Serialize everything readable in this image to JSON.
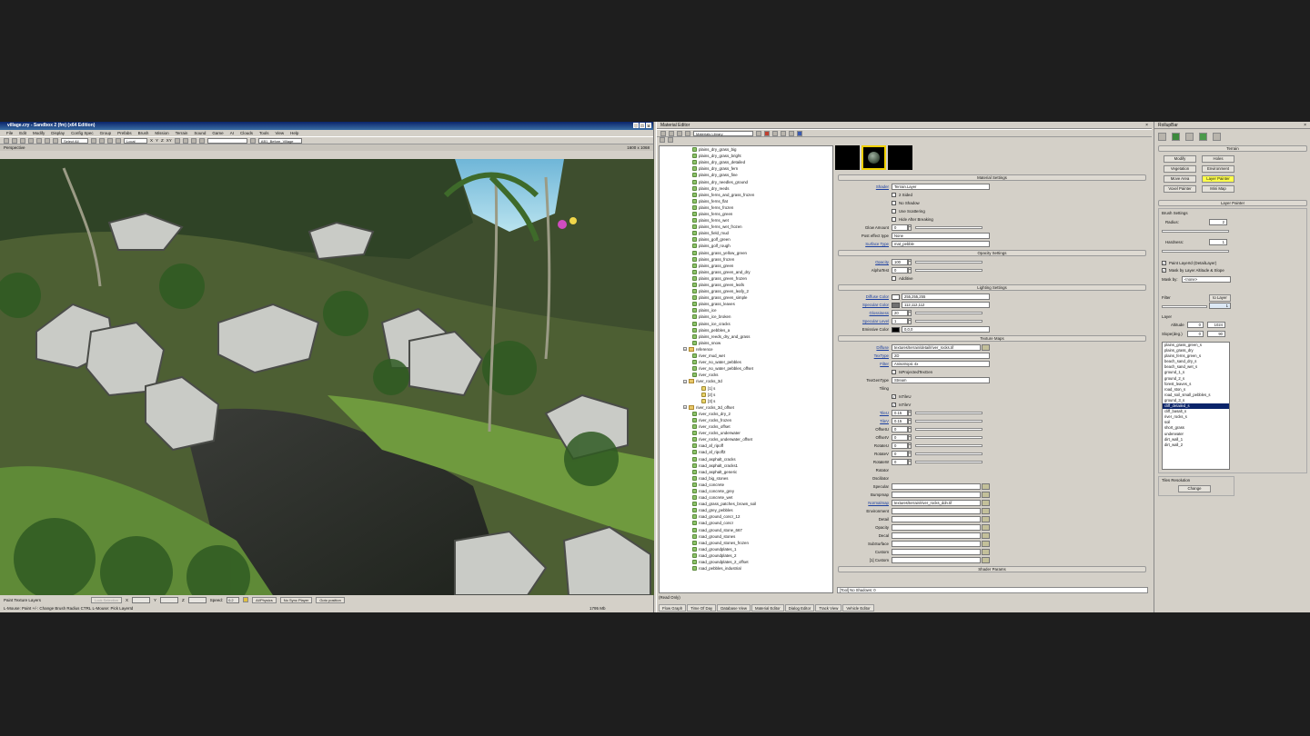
{
  "sandbox": {
    "title": "village.cry - Sandbox 2 (fm) (x64 Edition)",
    "menu": [
      "File",
      "Edit",
      "Modify",
      "Display",
      "Config Spec",
      "Group",
      "Prefabs",
      "Brush",
      "Mission",
      "Terrain",
      "Sound",
      "Game",
      "AI",
      "Clouds",
      "Tools",
      "View",
      "Help"
    ],
    "select_filter": "Select All",
    "coord_system": "Local",
    "axes": [
      "X",
      "Y",
      "Z",
      "XY"
    ],
    "camera_name": "AB1_Before_Village",
    "viewport_label": "Perspective",
    "viewport_size": "1600 x 1068",
    "status": {
      "mode": "Paint Texture Layers",
      "lock_selection": "Lock Selection",
      "x_label": "X",
      "y_label": "Y",
      "z_label": "Z",
      "speed_label": "Speed:",
      "speed_value": "0.2",
      "ai_physics": "AI/Physics",
      "no_sync": "No Sync Player",
      "goto": "Goto position",
      "hint": "L-Mouse: Paint   +/-: Change Brush Radius   CTRL L-Mouse: Pick LayerId",
      "memory": "1795 Mb"
    }
  },
  "material_editor": {
    "title": "Material Editor",
    "library_select": "Materials Library",
    "tree": [
      {
        "label": "plains_dry_grass_big",
        "type": "item"
      },
      {
        "label": "plains_dry_grass_bright",
        "type": "item"
      },
      {
        "label": "plains_dry_grass_detailed",
        "type": "item"
      },
      {
        "label": "plains_dry_grass_fern",
        "type": "item"
      },
      {
        "label": "plains_dry_grass_fine",
        "type": "item"
      },
      {
        "label": "plains_dry_needles_ground",
        "type": "item"
      },
      {
        "label": "plains_dry_reeds",
        "type": "item"
      },
      {
        "label": "plains_ferns_and_grass_frozen",
        "type": "item"
      },
      {
        "label": "plains_ferns_flat",
        "type": "item"
      },
      {
        "label": "plains_ferns_frozen",
        "type": "item"
      },
      {
        "label": "plains_ferns_green",
        "type": "item"
      },
      {
        "label": "plains_ferns_wet",
        "type": "item"
      },
      {
        "label": "plains_ferns_wet_frozen",
        "type": "item"
      },
      {
        "label": "plains_field_mud",
        "type": "item"
      },
      {
        "label": "plains_golf_green",
        "type": "item"
      },
      {
        "label": "plains_golf_rough",
        "type": "item"
      },
      {
        "label": "plains_grass_yellow_green",
        "type": "item"
      },
      {
        "label": "plains_grass_frozen",
        "type": "item"
      },
      {
        "label": "plains_grass_green",
        "type": "item"
      },
      {
        "label": "plains_grass_green_and_dry",
        "type": "item"
      },
      {
        "label": "plains_grass_green_frozen",
        "type": "item"
      },
      {
        "label": "plains_grass_green_leafs",
        "type": "item"
      },
      {
        "label": "plains_grass_green_leafy_2",
        "type": "item"
      },
      {
        "label": "plains_grass_green_simple",
        "type": "item"
      },
      {
        "label": "plains_grass_leaves",
        "type": "item"
      },
      {
        "label": "plains_ice",
        "type": "item"
      },
      {
        "label": "plains_ice_broken",
        "type": "item"
      },
      {
        "label": "plains_ice_cracks",
        "type": "item"
      },
      {
        "label": "plains_pebbles_a",
        "type": "item"
      },
      {
        "label": "plains_reeds_dry_and_grass",
        "type": "item"
      },
      {
        "label": "plains_snow",
        "type": "item"
      },
      {
        "label": "reference",
        "type": "folder"
      },
      {
        "label": "river_mud_wet",
        "type": "item"
      },
      {
        "label": "river_no_water_pebbles",
        "type": "item"
      },
      {
        "label": "river_no_water_pebbles_offset",
        "type": "item"
      },
      {
        "label": "river_rocks",
        "type": "item"
      },
      {
        "label": "river_rocks_3d",
        "type": "folder"
      },
      {
        "label": "[1] s",
        "type": "sub"
      },
      {
        "label": "[2] s",
        "type": "sub"
      },
      {
        "label": "[3] s",
        "type": "sub"
      },
      {
        "label": "river_rocks_3d_offset",
        "type": "folder"
      },
      {
        "label": "river_rocks_dry_2",
        "type": "item"
      },
      {
        "label": "river_rocks_frozen",
        "type": "item"
      },
      {
        "label": "river_rocks_offset",
        "type": "item"
      },
      {
        "label": "river_rocks_underwater",
        "type": "item"
      },
      {
        "label": "river_rocks_underwater_offset",
        "type": "item"
      },
      {
        "label": "road_af_ripoff",
        "type": "item"
      },
      {
        "label": "road_af_ripoff2",
        "type": "item"
      },
      {
        "label": "road_asphalt_cracks",
        "type": "item"
      },
      {
        "label": "road_asphalt_cracks1",
        "type": "item"
      },
      {
        "label": "road_asphalt_generic",
        "type": "item"
      },
      {
        "label": "road_big_stones",
        "type": "item"
      },
      {
        "label": "road_concrete",
        "type": "item"
      },
      {
        "label": "road_concrete_grey",
        "type": "item"
      },
      {
        "label": "road_concrete_wet",
        "type": "item"
      },
      {
        "label": "road_grass_patches_brown_soil",
        "type": "item"
      },
      {
        "label": "road_grey_pebbles",
        "type": "item"
      },
      {
        "label": "road_ground_concr_12",
        "type": "item"
      },
      {
        "label": "road_ground_concr",
        "type": "item"
      },
      {
        "label": "road_ground_stone_667",
        "type": "item"
      },
      {
        "label": "road_ground_stones",
        "type": "item"
      },
      {
        "label": "road_ground_stones_frozen",
        "type": "item"
      },
      {
        "label": "road_groundplates_1",
        "type": "item"
      },
      {
        "label": "road_groundplates_2",
        "type": "item"
      },
      {
        "label": "road_groundplates_2_offset",
        "type": "item"
      },
      {
        "label": "road_pebbles_industrial",
        "type": "item"
      }
    ],
    "tree_status": "(Read Only)",
    "material_settings": {
      "header": "Material Settings",
      "shader_label": "Shader",
      "shader_value": "Terrain.Layer",
      "checks": [
        {
          "label": "2 Sided",
          "checked": false
        },
        {
          "label": "No Shadow",
          "checked": false
        },
        {
          "label": "Use Scattering",
          "checked": false
        },
        {
          "label": "Hide After Breaking",
          "checked": false
        }
      ],
      "glow_label": "Glow Amount",
      "glow_value": "0",
      "post_effect_label": "Post effect type",
      "post_effect_value": "None",
      "surface_label": "Surface Type",
      "surface_value": "mat_pebble"
    },
    "opacity_settings": {
      "header": "Opacity Settings",
      "opacity_label": "Opacity",
      "opacity_value": "100",
      "alphatest_label": "AlphaTest",
      "alphatest_value": "0",
      "additive_label": "Additive"
    },
    "lighting_settings": {
      "header": "Lighting Settings",
      "diffuse_label": "Diffuse Color",
      "diffuse_value": "255,255,255",
      "specular_label": "Specular Color",
      "specular_value": "112,112,112",
      "gloss_label": "Glossiness",
      "gloss_value": "20",
      "spec_level_label": "Specular Level",
      "spec_level_value": "1",
      "emissive_label": "Emissive Color",
      "emissive_value": "0,0,0"
    },
    "texture_maps": {
      "header": "Texture Maps",
      "diffuse_label": "Diffuse",
      "diffuse_path": "textures/terrain/detail/river_rocks.tif",
      "textype_label": "TexType",
      "textype_value": "2D",
      "filter_label": "Filter",
      "filter_value": "Anisotropic 4x",
      "projected_label": "IsProjectedTexGen",
      "texgen_label": "TexGenType",
      "texgen_value": "Stream",
      "tiling_label": "Tiling",
      "istileu": "IsTileU",
      "istilev": "IsTileV",
      "numbers": [
        {
          "label": "TileU",
          "value": "0.15",
          "blue": true
        },
        {
          "label": "TileV",
          "value": "0.15",
          "blue": true
        },
        {
          "label": "OffsetU",
          "value": "0",
          "blue": false
        },
        {
          "label": "OffsetV",
          "value": "0",
          "blue": false
        },
        {
          "label": "RotateU",
          "value": "0",
          "blue": false
        },
        {
          "label": "RotateV",
          "value": "0",
          "blue": false
        },
        {
          "label": "RotateW",
          "value": "0",
          "blue": false
        }
      ],
      "rotator_label": "Rotator",
      "oscillator_label": "Oscillator",
      "slots": [
        {
          "label": "Specular",
          "value": "",
          "blue": false
        },
        {
          "label": "Bumpmap",
          "value": "",
          "blue": false
        },
        {
          "label": "Normalmap",
          "value": "textures/terrain/river_rocks_ddn.tif",
          "blue": true
        },
        {
          "label": "Environment",
          "value": "",
          "blue": false
        },
        {
          "label": "Detail",
          "value": "",
          "blue": false
        },
        {
          "label": "Opacity",
          "value": "",
          "blue": false
        },
        {
          "label": "Decal",
          "value": "",
          "blue": false
        },
        {
          "label": "SubSurface",
          "value": "",
          "blue": false
        },
        {
          "label": "Custom",
          "value": "",
          "blue": false
        },
        {
          "label": "[1] Custom",
          "value": "",
          "blue": false
        }
      ],
      "shader_params": "Shader Params"
    },
    "props_status": "[Tool] No Shadows: 0",
    "tabs": [
      "Flow Graph",
      "Time Of Day",
      "Database View",
      "Material Editor",
      "Dialog Editor",
      "Track View",
      "Vehicle Editor"
    ]
  },
  "rollup": {
    "title": "RollupBar",
    "terrain_header": "Terrain",
    "buttons": [
      "Modify",
      "Holes",
      "Vegetation",
      "Environment",
      "Move Area",
      "Layer Painter",
      "Voxel Painter",
      "Mini Map"
    ],
    "active_button": "Layer Painter",
    "layer_painter_header": "Layer Painter",
    "brush_settings": "Brush Settings",
    "radius_label": "Radius:",
    "radius_value": "2",
    "hardness_label": "Hardness:",
    "hardness_value": "1",
    "paint_layerid": "Paint LayerId (DetailLayer)",
    "mask_by_layer": "Mask by Layer Altitude & Slope",
    "mask_by_label": "Mask by:",
    "mask_by_value": "<none>",
    "filter_label": "Filter",
    "to_layer": "to Layer",
    "filter_value": "1",
    "layer_label": "Layer",
    "altitude_label": "Altitude",
    "altitude_min": "0",
    "altitude_max": "1024",
    "slope_label": "Slope(deg.)",
    "slope_min": "0",
    "slope_max": "90",
    "layers": [
      "plains_grass_green_s",
      "plains_grass_dry",
      "plains_ferns_green_s",
      "beach_sand_dry_s",
      "beach_sand_wet_s",
      "ground_1_s",
      "ground_2_s",
      "forest_leaves_s",
      "road_ston_s",
      "road_soil_small_pebbles_s",
      "ground_3_s",
      "cliff_detailed_s",
      "cliff_basalt_s",
      "river_rocks_s",
      "soil",
      "short_grass",
      "underwater",
      "dirt_wall_1",
      "dirt_wall_2"
    ],
    "selected_layer": "cliff_detailed_s",
    "tiles_resolution": "Tiles Resolution",
    "change": "Change"
  }
}
